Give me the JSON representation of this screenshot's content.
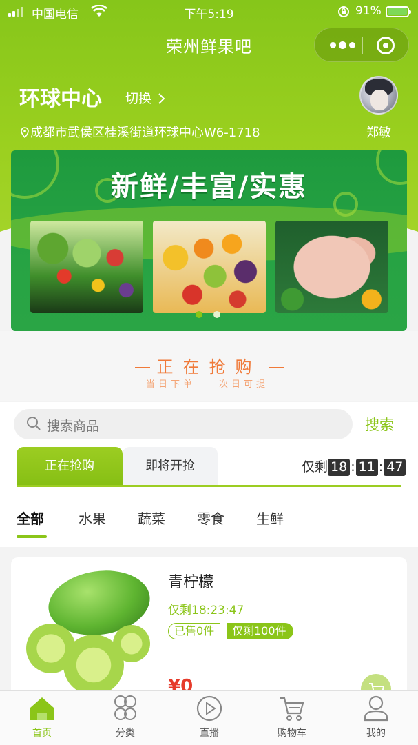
{
  "status_bar": {
    "carrier": "中国电信",
    "time": "下午5:19",
    "battery": "91%"
  },
  "nav": {
    "title": "荣州鲜果吧"
  },
  "store": {
    "name": "环球中心",
    "switch_label": "切换",
    "address": "成都市武侯区桂溪街道环球中心W6-1718"
  },
  "user": {
    "name": "郑敏"
  },
  "banner": {
    "title": "新鲜/丰富/实惠",
    "images": [
      "vegetables",
      "fruits",
      "chicken"
    ],
    "active_dot": 0,
    "dot_count": 2
  },
  "flash_section": {
    "title": "正在抢购",
    "subtitle_left": "当日下单",
    "subtitle_right": "次日可提"
  },
  "search": {
    "placeholder": "搜索商品",
    "button": "搜索"
  },
  "sale_tabs": {
    "active": "正在抢购",
    "next": "即将开抢"
  },
  "countdown": {
    "label": "仅剩",
    "hours": "18",
    "minutes": "11",
    "seconds": "47"
  },
  "categories": [
    "全部",
    "水果",
    "蔬菜",
    "零食",
    "生鲜"
  ],
  "products": [
    {
      "name": "青柠檬",
      "remaining_time": "仅剩18:23:47",
      "sold": "已售0件",
      "stock": "仅剩100件",
      "price": "¥0"
    }
  ],
  "tabbar": [
    {
      "label": "首页",
      "icon": "home-icon"
    },
    {
      "label": "分类",
      "icon": "category-icon"
    },
    {
      "label": "直播",
      "icon": "live-play-icon"
    },
    {
      "label": "购物车",
      "icon": "cart-icon"
    },
    {
      "label": "我的",
      "icon": "profile-icon"
    }
  ],
  "colors": {
    "brand_green": "#8bc519",
    "banner_green": "#27a344",
    "flash_orange": "#f07a39",
    "price_red": "#e63b2b"
  }
}
